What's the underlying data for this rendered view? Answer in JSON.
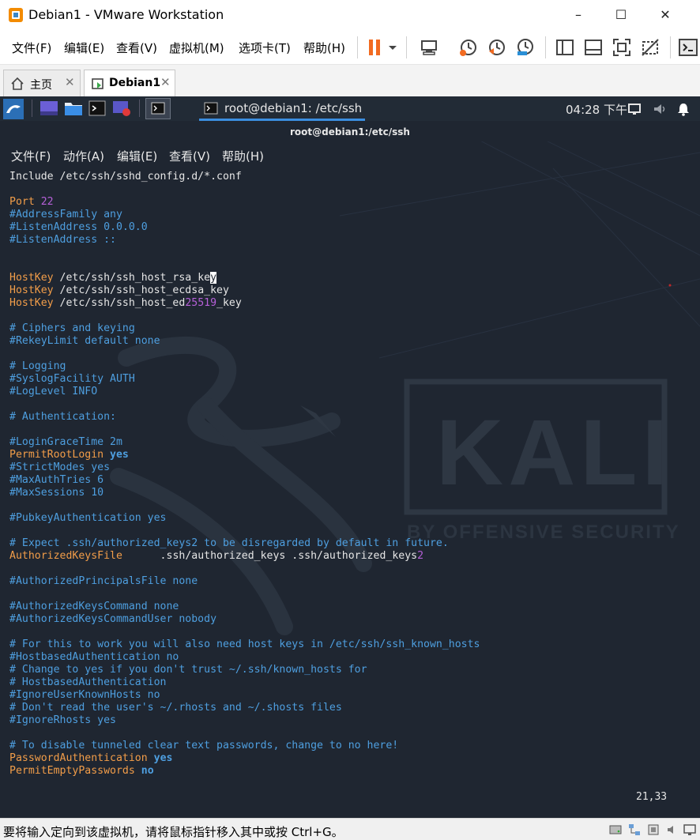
{
  "window": {
    "title": "Debian1 - VMware Workstation",
    "minimize": "–",
    "maximize": "☐",
    "close": "✕"
  },
  "menubar": {
    "items": [
      "文件(F)",
      "编辑(E)",
      "查看(V)",
      "虚拟机(M)",
      "选项卡(T)",
      "帮助(H)"
    ]
  },
  "tabs": [
    {
      "label": "主页",
      "close": "✕"
    },
    {
      "label": "Debian1",
      "close": "✕"
    }
  ],
  "kali_panel": {
    "task_title": "root@debian1: /etc/ssh",
    "clock": "04:28 下午"
  },
  "terminal": {
    "title": "root@debian1:/etc/ssh",
    "menu": [
      "文件(F)",
      "动作(A)",
      "编辑(E)",
      "查看(V)",
      "帮助(H)"
    ],
    "cursor_position": "21,33",
    "lines": [
      [
        {
          "t": "Include /etc/ssh/sshd_config.d/*.conf",
          "c": "plain"
        }
      ],
      [],
      [
        {
          "t": "Port ",
          "c": "key"
        },
        {
          "t": "22",
          "c": "num"
        }
      ],
      [
        {
          "t": "#AddressFamily any",
          "c": "comment"
        }
      ],
      [
        {
          "t": "#ListenAddress 0.0.0.0",
          "c": "comment"
        }
      ],
      [
        {
          "t": "#ListenAddress ::",
          "c": "comment"
        }
      ],
      [],
      [],
      [
        {
          "t": "HostKey",
          "c": "key"
        },
        {
          "t": " /etc/ssh/ssh_host_rsa_ke",
          "c": "plain"
        },
        {
          "t": "y",
          "c": "cursor"
        }
      ],
      [
        {
          "t": "HostKey",
          "c": "key"
        },
        {
          "t": " /etc/ssh/ssh_host_ecdsa_key",
          "c": "plain"
        }
      ],
      [
        {
          "t": "HostKey",
          "c": "key"
        },
        {
          "t": " /etc/ssh/ssh_host_ed",
          "c": "plain"
        },
        {
          "t": "25519",
          "c": "num"
        },
        {
          "t": "_key",
          "c": "plain"
        }
      ],
      [],
      [
        {
          "t": "# Ciphers and keying",
          "c": "comment"
        }
      ],
      [
        {
          "t": "#RekeyLimit default none",
          "c": "comment"
        }
      ],
      [],
      [
        {
          "t": "# Logging",
          "c": "comment"
        }
      ],
      [
        {
          "t": "#SyslogFacility AUTH",
          "c": "comment"
        }
      ],
      [
        {
          "t": "#LogLevel INFO",
          "c": "comment"
        }
      ],
      [],
      [
        {
          "t": "# Authentication:",
          "c": "comment"
        }
      ],
      [],
      [
        {
          "t": "#LoginGraceTime 2m",
          "c": "comment"
        }
      ],
      [
        {
          "t": "PermitRootLogin",
          "c": "key"
        },
        {
          "t": " ",
          "c": "plain"
        },
        {
          "t": "yes",
          "c": "bool"
        }
      ],
      [
        {
          "t": "#StrictModes yes",
          "c": "comment"
        }
      ],
      [
        {
          "t": "#MaxAuthTries 6",
          "c": "comment"
        }
      ],
      [
        {
          "t": "#MaxSessions 10",
          "c": "comment"
        }
      ],
      [],
      [
        {
          "t": "#PubkeyAuthentication yes",
          "c": "comment"
        }
      ],
      [],
      [
        {
          "t": "# Expect .ssh/authorized_keys2 to be disregarded by default in future.",
          "c": "comment"
        }
      ],
      [
        {
          "t": "AuthorizedKeysFile",
          "c": "key"
        },
        {
          "t": "      .ssh/authorized_keys .ssh/authorized_keys",
          "c": "plain"
        },
        {
          "t": "2",
          "c": "num"
        }
      ],
      [],
      [
        {
          "t": "#AuthorizedPrincipalsFile none",
          "c": "comment"
        }
      ],
      [],
      [
        {
          "t": "#AuthorizedKeysCommand none",
          "c": "comment"
        }
      ],
      [
        {
          "t": "#AuthorizedKeysCommandUser nobody",
          "c": "comment"
        }
      ],
      [],
      [
        {
          "t": "# For this to work you will also need host keys in /etc/ssh/ssh_known_hosts",
          "c": "comment"
        }
      ],
      [
        {
          "t": "#HostbasedAuthentication no",
          "c": "comment"
        }
      ],
      [
        {
          "t": "# Change to yes if you don't trust ~/.ssh/known_hosts for",
          "c": "comment"
        }
      ],
      [
        {
          "t": "# HostbasedAuthentication",
          "c": "comment"
        }
      ],
      [
        {
          "t": "#IgnoreUserKnownHosts no",
          "c": "comment"
        }
      ],
      [
        {
          "t": "# Don't read the user's ~/.rhosts and ~/.shosts files",
          "c": "comment"
        }
      ],
      [
        {
          "t": "#IgnoreRhosts yes",
          "c": "comment"
        }
      ],
      [],
      [
        {
          "t": "# To disable tunneled clear text passwords, change to no here!",
          "c": "comment"
        }
      ],
      [
        {
          "t": "PasswordAuthentication",
          "c": "key"
        },
        {
          "t": " ",
          "c": "plain"
        },
        {
          "t": "yes",
          "c": "bool"
        }
      ],
      [
        {
          "t": "PermitEmptyPasswords",
          "c": "key"
        },
        {
          "t": " ",
          "c": "plain"
        },
        {
          "t": "no",
          "c": "bool"
        }
      ]
    ]
  },
  "watermark": {
    "logo_text": "KALI",
    "tagline": "BY OFFENSIVE SECURITY"
  },
  "statusbar": {
    "text": "要将输入定向到该虚拟机，请将鼠标指针移入其中或按 Ctrl+G。"
  },
  "colors": {
    "terminal_bg": "#1f2631",
    "keyword": "#f29d49",
    "comment": "#4e9fe0",
    "number": "#b660d9",
    "pause_accent": "#f26b21"
  }
}
